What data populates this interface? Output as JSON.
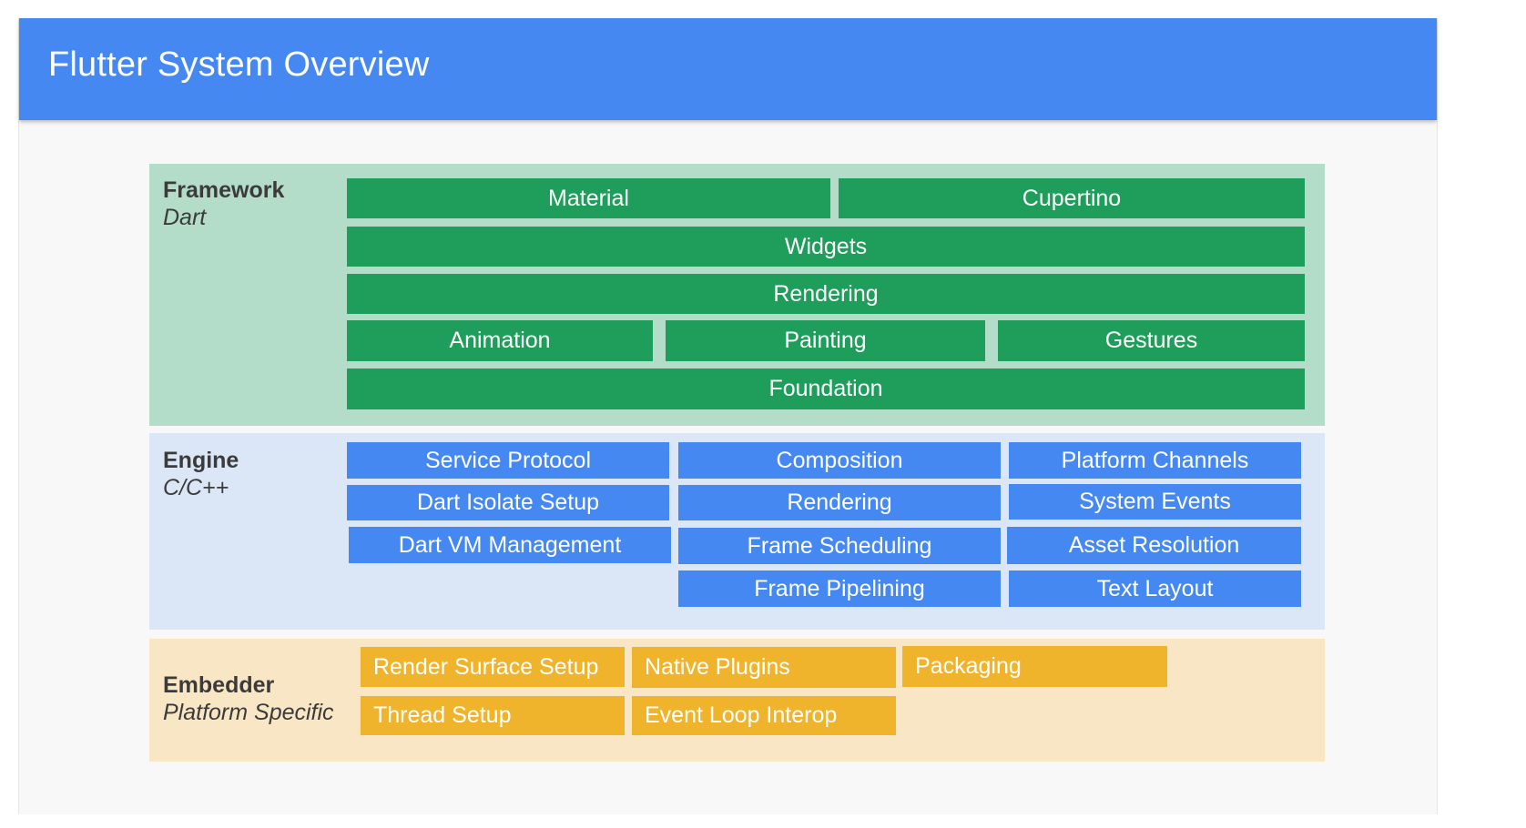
{
  "title": "Flutter System Overview",
  "colors": {
    "header": "#4688f1",
    "framework_bg": "#b3ddc8",
    "framework_box": "#1e9e5a",
    "engine_bg": "#dbe6f7",
    "engine_box": "#4688f1",
    "embedder_bg": "#f8e6c4",
    "embedder_box": "#f0b42c"
  },
  "framework": {
    "name": "Framework",
    "language": "Dart",
    "material": "Material",
    "cupertino": "Cupertino",
    "widgets": "Widgets",
    "rendering": "Rendering",
    "animation": "Animation",
    "painting": "Painting",
    "gestures": "Gestures",
    "foundation": "Foundation"
  },
  "engine": {
    "name": "Engine",
    "language": "C/C++",
    "service_protocol": "Service Protocol",
    "dart_isolate_setup": "Dart Isolate Setup",
    "dart_vm_management": "Dart VM Management",
    "composition": "Composition",
    "rendering": "Rendering",
    "frame_scheduling": "Frame Scheduling",
    "frame_pipelining": "Frame Pipelining",
    "platform_channels": "Platform Channels",
    "system_events": "System Events",
    "asset_resolution": "Asset Resolution",
    "text_layout": "Text Layout"
  },
  "embedder": {
    "name": "Embedder",
    "language": "Platform Specific",
    "render_surface_setup": "Render Surface Setup",
    "native_plugins": "Native Plugins",
    "packaging": "Packaging",
    "thread_setup": "Thread Setup",
    "event_loop_interop": "Event Loop Interop"
  }
}
